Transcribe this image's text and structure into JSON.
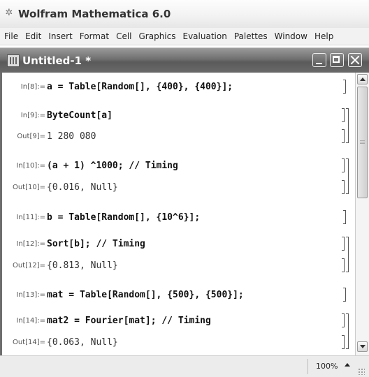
{
  "app": {
    "title": "Wolfram Mathematica 6.0"
  },
  "menu": [
    "File",
    "Edit",
    "Insert",
    "Format",
    "Cell",
    "Graphics",
    "Evaluation",
    "Palettes",
    "Window",
    "Help"
  ],
  "document": {
    "title": "Untitled-1 *"
  },
  "cells": [
    {
      "label": "In[8]:=",
      "code": "a = Table[Random[], {400}, {400}];"
    },
    {
      "label": "In[9]:=",
      "code": "ByteCount[a]"
    },
    {
      "label": "Out[9]=",
      "code": "1 280 080"
    },
    {
      "label": "In[10]:=",
      "code": "(a + 1) ^1000; // Timing"
    },
    {
      "label": "Out[10]=",
      "code": "{0.016, Null}"
    },
    {
      "label": "In[11]:=",
      "code": "b = Table[Random[], {10^6}];"
    },
    {
      "label": "In[12]:=",
      "code": "Sort[b]; // Timing"
    },
    {
      "label": "Out[12]=",
      "code": "{0.813, Null}"
    },
    {
      "label": "In[13]:=",
      "code": "mat = Table[Random[], {500}, {500}];"
    },
    {
      "label": "In[14]:=",
      "code": "mat2 = Fourier[mat]; // Timing"
    },
    {
      "label": "Out[14]=",
      "code": "{0.063, Null}"
    }
  ],
  "status": {
    "zoom": "100%"
  }
}
